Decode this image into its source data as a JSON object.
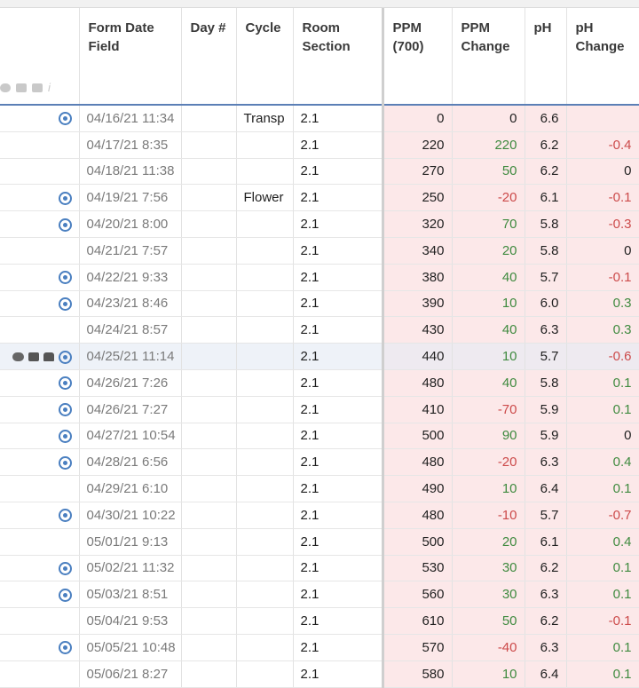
{
  "columns": {
    "date": "Form Date Field",
    "day": "Day #",
    "cycle": "Cycle",
    "room": "Room Section",
    "ppm": "PPM (700)",
    "ppm_change": "PPM Change",
    "ph": "pH",
    "ph_change": "pH Change"
  },
  "header_icons": [
    "comment-icon",
    "chat-icon",
    "folder-icon",
    "info-icon"
  ],
  "header_info_glyph": "i",
  "colors": {
    "positive": "#3f8a3f",
    "negative": "#cc4a4a",
    "numeric_bg": "#fce8e9",
    "header_rule": "#5b7fb6",
    "sync_icon": "#4a7fc0"
  },
  "rows": [
    {
      "sync": true,
      "date": "04/16/21 11:34",
      "day": "",
      "cycle": "Transp",
      "room": "2.1",
      "ppm": "0",
      "ppm_change": "0",
      "ph": "6.6",
      "ph_change": ""
    },
    {
      "sync": false,
      "date": "04/17/21 8:35",
      "day": "",
      "cycle": "",
      "room": "2.1",
      "ppm": "220",
      "ppm_change": "220",
      "ph": "6.2",
      "ph_change": "-0.4"
    },
    {
      "sync": false,
      "date": "04/18/21 11:38",
      "day": "",
      "cycle": "",
      "room": "2.1",
      "ppm": "270",
      "ppm_change": "50",
      "ph": "6.2",
      "ph_change": "0"
    },
    {
      "sync": true,
      "date": "04/19/21 7:56",
      "day": "",
      "cycle": "Flower",
      "room": "2.1",
      "ppm": "250",
      "ppm_change": "-20",
      "ph": "6.1",
      "ph_change": "-0.1"
    },
    {
      "sync": true,
      "date": "04/20/21 8:00",
      "day": "",
      "cycle": "",
      "room": "2.1",
      "ppm": "320",
      "ppm_change": "70",
      "ph": "5.8",
      "ph_change": "-0.3"
    },
    {
      "sync": false,
      "date": "04/21/21 7:57",
      "day": "",
      "cycle": "",
      "room": "2.1",
      "ppm": "340",
      "ppm_change": "20",
      "ph": "5.8",
      "ph_change": "0"
    },
    {
      "sync": true,
      "date": "04/22/21 9:33",
      "day": "",
      "cycle": "",
      "room": "2.1",
      "ppm": "380",
      "ppm_change": "40",
      "ph": "5.7",
      "ph_change": "-0.1"
    },
    {
      "sync": true,
      "date": "04/23/21 8:46",
      "day": "",
      "cycle": "",
      "room": "2.1",
      "ppm": "390",
      "ppm_change": "10",
      "ph": "6.0",
      "ph_change": "0.3"
    },
    {
      "sync": false,
      "date": "04/24/21 8:57",
      "day": "",
      "cycle": "",
      "room": "2.1",
      "ppm": "430",
      "ppm_change": "40",
      "ph": "6.3",
      "ph_change": "0.3"
    },
    {
      "sync": true,
      "selected": true,
      "row_icons": true,
      "date": "04/25/21 11:14",
      "day": "",
      "cycle": "",
      "room": "2.1",
      "ppm": "440",
      "ppm_change": "10",
      "ph": "5.7",
      "ph_change": "-0.6"
    },
    {
      "sync": true,
      "date": "04/26/21 7:26",
      "day": "",
      "cycle": "",
      "room": "2.1",
      "ppm": "480",
      "ppm_change": "40",
      "ph": "5.8",
      "ph_change": "0.1"
    },
    {
      "sync": true,
      "date": "04/26/21 7:27",
      "day": "",
      "cycle": "",
      "room": "2.1",
      "ppm": "410",
      "ppm_change": "-70",
      "ph": "5.9",
      "ph_change": "0.1"
    },
    {
      "sync": true,
      "date": "04/27/21 10:54",
      "day": "",
      "cycle": "",
      "room": "2.1",
      "ppm": "500",
      "ppm_change": "90",
      "ph": "5.9",
      "ph_change": "0"
    },
    {
      "sync": true,
      "date": "04/28/21 6:56",
      "day": "",
      "cycle": "",
      "room": "2.1",
      "ppm": "480",
      "ppm_change": "-20",
      "ph": "6.3",
      "ph_change": "0.4"
    },
    {
      "sync": false,
      "date": "04/29/21 6:10",
      "day": "",
      "cycle": "",
      "room": "2.1",
      "ppm": "490",
      "ppm_change": "10",
      "ph": "6.4",
      "ph_change": "0.1"
    },
    {
      "sync": true,
      "date": "04/30/21 10:22",
      "day": "",
      "cycle": "",
      "room": "2.1",
      "ppm": "480",
      "ppm_change": "-10",
      "ph": "5.7",
      "ph_change": "-0.7"
    },
    {
      "sync": false,
      "date": "05/01/21 9:13",
      "day": "",
      "cycle": "",
      "room": "2.1",
      "ppm": "500",
      "ppm_change": "20",
      "ph": "6.1",
      "ph_change": "0.4"
    },
    {
      "sync": true,
      "date": "05/02/21 11:32",
      "day": "",
      "cycle": "",
      "room": "2.1",
      "ppm": "530",
      "ppm_change": "30",
      "ph": "6.2",
      "ph_change": "0.1"
    },
    {
      "sync": true,
      "date": "05/03/21 8:51",
      "day": "",
      "cycle": "",
      "room": "2.1",
      "ppm": "560",
      "ppm_change": "30",
      "ph": "6.3",
      "ph_change": "0.1"
    },
    {
      "sync": false,
      "date": "05/04/21 9:53",
      "day": "",
      "cycle": "",
      "room": "2.1",
      "ppm": "610",
      "ppm_change": "50",
      "ph": "6.2",
      "ph_change": "-0.1"
    },
    {
      "sync": true,
      "date": "05/05/21 10:48",
      "day": "",
      "cycle": "",
      "room": "2.1",
      "ppm": "570",
      "ppm_change": "-40",
      "ph": "6.3",
      "ph_change": "0.1"
    },
    {
      "sync": false,
      "date": "05/06/21 8:27",
      "day": "",
      "cycle": "",
      "room": "2.1",
      "ppm": "580",
      "ppm_change": "10",
      "ph": "6.4",
      "ph_change": "0.1"
    }
  ]
}
